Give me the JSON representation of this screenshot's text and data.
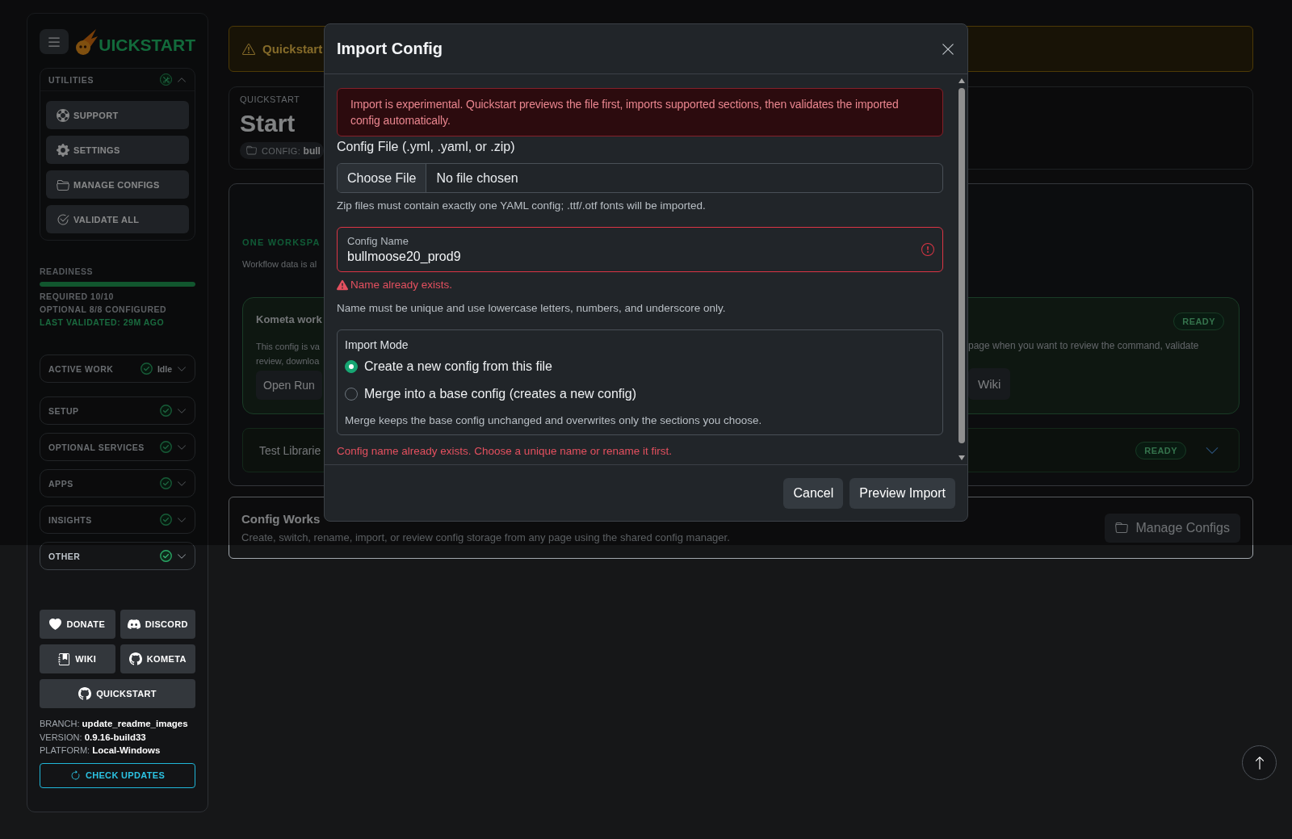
{
  "sidebar": {
    "logo": {
      "text": "UICKSTART"
    },
    "utilities": {
      "title": "UTILITIES",
      "expanded": true,
      "items": [
        {
          "label": "SUPPORT"
        },
        {
          "label": "SETTINGS"
        },
        {
          "label": "MANAGE CONFIGS"
        },
        {
          "label": "VALIDATE ALL"
        }
      ]
    },
    "readiness": {
      "label": "READINESS",
      "level": 1,
      "lines": [
        "REQUIRED 10/10",
        "OPTIONAL 8/8 CONFIGURED"
      ],
      "last_validated": "LAST VALIDATED: 29M AGO"
    },
    "active_work": {
      "title": "ACTIVE WORK",
      "status": "Idle",
      "complete": true,
      "expanded": false
    },
    "sections": [
      {
        "title": "SETUP",
        "complete": true,
        "expanded": false
      },
      {
        "title": "OPTIONAL SERVICES",
        "complete": true,
        "expanded": false
      },
      {
        "title": "APPS",
        "complete": true,
        "expanded": false
      },
      {
        "title": "INSIGHTS",
        "complete": true,
        "expanded": false
      },
      {
        "title": "OTHER",
        "complete": true,
        "expanded": false
      }
    ],
    "links": [
      {
        "label": "DONATE"
      },
      {
        "label": "DISCORD"
      },
      {
        "label": "WIKI"
      },
      {
        "label": "KOMETA"
      },
      {
        "label": "QUICKSTART"
      }
    ],
    "build_info": [
      {
        "label": "BRANCH:",
        "value": "update_readme_images"
      },
      {
        "label": "VERSION:",
        "value": "0.9.16-build33"
      },
      {
        "label": "PLATFORM:",
        "value": "Local-Windows"
      }
    ],
    "check_updates": {
      "label": "CHECK UPDATES"
    }
  },
  "main": {
    "banner": {
      "text": "Quickstart"
    },
    "header": {
      "eyebrow": "QUICKSTART",
      "title": "Start",
      "config_label": "CONFIG:",
      "config_value": "bull"
    },
    "workflow": {
      "heading": "ONE WORKSPA",
      "text": "Workflow data is al",
      "kometa_card": {
        "title": "Kometa work",
        "lines": [
          "This config is va",
          "review, downloa"
        ],
        "button": "Open Run",
        "badge": "READY",
        "right_text": "page when you want to review the command, validate",
        "right_button": "Wiki"
      },
      "test_card": {
        "title": "Test Librarie",
        "badge": "READY",
        "expanded": false
      }
    },
    "config_workspace": {
      "title": "Config Works",
      "text": "Create, switch, rename, import, or review config storage from any page using the shared config manager.",
      "button": "Manage Configs"
    }
  },
  "modal": {
    "title": "Import Config",
    "alert": "Import is experimental. Quickstart previews the file first, imports supported sections, then validates the imported config automatically.",
    "file_field": {
      "label": "Config File (.yml, .yaml, or .zip)",
      "button": "Choose File",
      "value": "No file chosen",
      "help": "Zip files must contain exactly one YAML config; .ttf/.otf fonts will be imported."
    },
    "name_field": {
      "label": "Config Name",
      "value": "bullmoose20_prod9",
      "invalid": true,
      "error": "Name already exists.",
      "help": "Name must be unique and use lowercase letters, numbers, and underscore only."
    },
    "import_mode": {
      "legend": "Import Mode",
      "options": [
        {
          "label": "Create a new config from this file",
          "selected": true
        },
        {
          "label": "Merge into a base config (creates a new config)",
          "selected": false
        }
      ],
      "help": "Merge keeps the base config unchanged and overwrites only the sections you choose."
    },
    "error": "Config name already exists. Choose a unique name or rename it first.",
    "buttons": [
      {
        "label": "Cancel"
      },
      {
        "label": "Preview Import"
      }
    ]
  }
}
